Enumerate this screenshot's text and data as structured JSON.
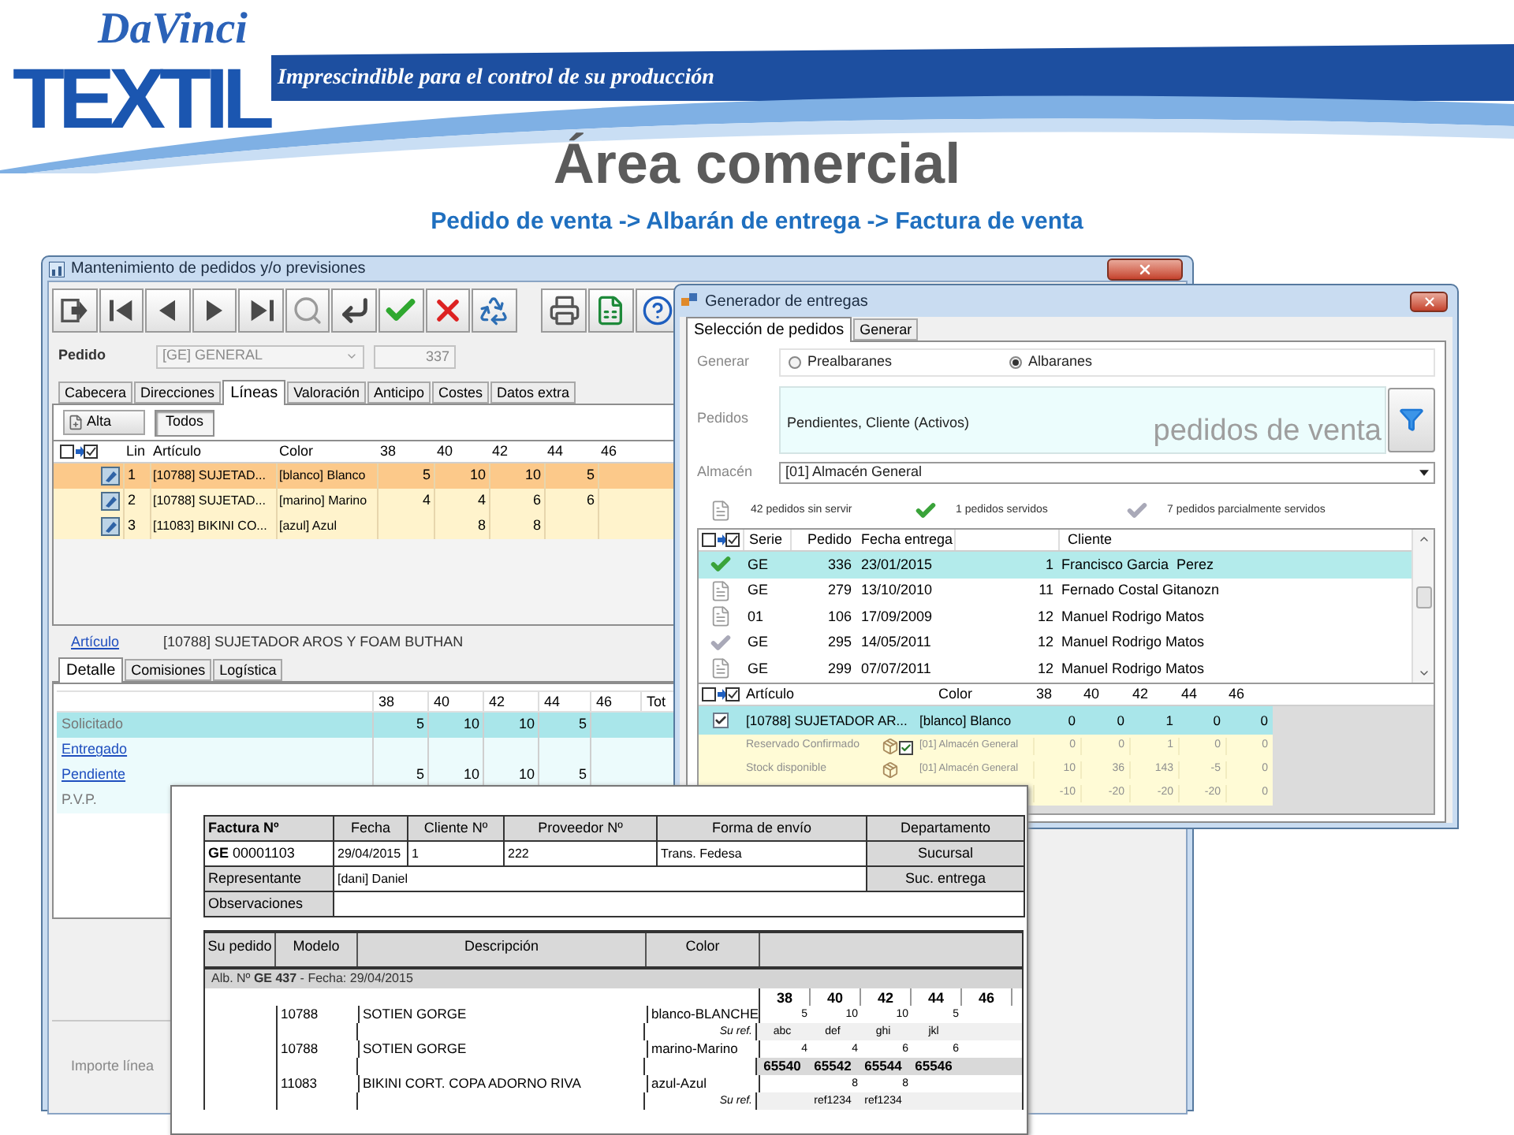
{
  "slide": {
    "logo_top": "DaVinci",
    "logo_main": "TEXTIL",
    "tagline": "Imprescindible para el control de su producción",
    "title": "Área comercial",
    "subtitle": "Pedido de venta -> Albarán de entrega -> Factura de venta"
  },
  "window_pedidos": {
    "title": "Mantenimiento de pedidos y/o previsiones",
    "pedido_label": "Pedido",
    "serie_value": "[GE] GENERAL",
    "numero_value": "337",
    "tabs": [
      {
        "label": "Cabecera",
        "selected": false
      },
      {
        "label": "Direcciones",
        "selected": false
      },
      {
        "label": "Líneas",
        "selected": true
      },
      {
        "label": "Valoración",
        "selected": false
      },
      {
        "label": "Anticipo",
        "selected": false
      },
      {
        "label": "Costes",
        "selected": false
      },
      {
        "label": "Datos extra",
        "selected": false
      }
    ],
    "alta_button": "Alta",
    "todos_toggle": {
      "label": "Todos",
      "pressed": true
    },
    "grid": {
      "columns": [
        "Lin",
        "Artículo",
        "Color",
        "38",
        "40",
        "42",
        "44",
        "46"
      ],
      "rows": [
        {
          "selected": true,
          "lin": "1",
          "articulo": "[10788] SUJETAD...",
          "color_label": "[blanco] Blanco",
          "qty": {
            "s38": "5",
            "s40": "10",
            "s42": "10",
            "s44": "5"
          }
        },
        {
          "selected": false,
          "lin": "2",
          "articulo": "[10788] SUJETAD...",
          "color_label": "[marino] Marino",
          "qty": {
            "s38": "4",
            "s40": "4",
            "s42": "6",
            "s44": "6"
          }
        },
        {
          "selected": false,
          "lin": "3",
          "articulo": "[11083] BIKINI CO...",
          "color_label": "[azul] Azul",
          "qty": {
            "s40": "8",
            "s42": "8"
          }
        }
      ]
    },
    "articulo_link": "Artículo",
    "articulo_value": "[10788] SUJETADOR AROS Y FOAM BUTHAN",
    "detail_tabs": [
      {
        "label": "Detalle",
        "selected": true
      },
      {
        "label": "Comisiones",
        "selected": false
      },
      {
        "label": "Logística",
        "selected": false
      }
    ],
    "detail": {
      "columns": [
        "38",
        "40",
        "42",
        "44",
        "46",
        "Tot"
      ],
      "rows": [
        {
          "label": "Solicitado",
          "kind": "text",
          "selected": true,
          "values": {
            "s38": "5",
            "s40": "10",
            "s42": "10",
            "s44": "5"
          }
        },
        {
          "label": "Entregado",
          "kind": "link",
          "selected": false
        },
        {
          "label": "Pendiente",
          "kind": "link",
          "selected": false,
          "values": {
            "s38": "5",
            "s40": "10",
            "s42": "10",
            "s44": "5"
          }
        },
        {
          "label": "P.V.P.",
          "kind": "text",
          "selected": false
        }
      ]
    },
    "importe_label": "Importe línea"
  },
  "window_entregas": {
    "title": "Generador de entregas",
    "tabs": [
      {
        "label": "Selección de pedidos",
        "selected": true
      },
      {
        "label": "Generar",
        "selected": false
      }
    ],
    "generar_label": "Generar",
    "radios": [
      {
        "label": "Prealbaranes",
        "selected": false
      },
      {
        "label": "Albaranes",
        "selected": true
      }
    ],
    "pedidos_label": "Pedidos",
    "pedidos_value": "Pendientes, Cliente (Activos)",
    "watermark": "pedidos de venta",
    "almacen_label": "Almacén",
    "almacen_value": "[01] Almacén General",
    "legend": [
      {
        "kind": "pending",
        "label": "42 pedidos sin servir"
      },
      {
        "kind": "served",
        "label": "1 pedidos servidos"
      },
      {
        "kind": "partial",
        "label": "7 pedidos parcialmente servidos"
      }
    ],
    "orders": {
      "columns": [
        "Serie",
        "Pedido",
        "Fecha entrega",
        "Cliente"
      ],
      "rows": [
        {
          "kind": "served",
          "selected": true,
          "serie": "GE",
          "pedido": "336",
          "fecha": "23/01/2015",
          "cliente_num": "1",
          "cliente": "Francisco Garcia  Perez"
        },
        {
          "kind": "pending",
          "selected": false,
          "serie": "GE",
          "pedido": "279",
          "fecha": "13/10/2010",
          "cliente_num": "11",
          "cliente": "Fernado Costal Gitanozn"
        },
        {
          "kind": "pending",
          "selected": false,
          "serie": "01",
          "pedido": "106",
          "fecha": "17/09/2009",
          "cliente_num": "12",
          "cliente": "Manuel Rodrigo Matos"
        },
        {
          "kind": "partial",
          "selected": false,
          "serie": "GE",
          "pedido": "295",
          "fecha": "14/05/2011",
          "cliente_num": "12",
          "cliente": "Manuel Rodrigo Matos"
        },
        {
          "kind": "pending",
          "selected": false,
          "serie": "GE",
          "pedido": "299",
          "fecha": "07/07/2011",
          "cliente_num": "12",
          "cliente": "Manuel Rodrigo Matos"
        }
      ]
    },
    "lines": {
      "columns": [
        "Artículo",
        "Color",
        "38",
        "40",
        "42",
        "44",
        "46"
      ],
      "rows": [
        {
          "kind": "line",
          "checked": true,
          "articulo": "[10788] SUJETADOR AR...",
          "color_label": "[blanco] Blanco",
          "values": [
            "0",
            "0",
            "1",
            "0",
            "0"
          ]
        },
        {
          "kind": "stock",
          "confirmed": true,
          "label": "Reservado Confirmado",
          "almacen": "[01] Almacén General",
          "values": [
            "0",
            "0",
            "1",
            "0",
            "0"
          ]
        },
        {
          "kind": "stock",
          "confirmed": false,
          "label": "Stock disponible",
          "almacen": "[01] Almacén General",
          "values": [
            "10",
            "36",
            "143",
            "-5",
            "0"
          ]
        },
        {
          "kind": "stock",
          "values": [
            "-10",
            "-20",
            "-20",
            "-20",
            "0"
          ]
        }
      ]
    }
  },
  "invoice": {
    "header_columns": [
      "Factura Nº",
      "Fecha",
      "Cliente Nº",
      "Proveedor Nº",
      "Forma de envío",
      "Departamento"
    ],
    "factura": "**GE** 00001103",
    "fecha": "29/04/2015",
    "cliente": "1",
    "proveedor": "222",
    "forma_envio": "Trans. Fedesa",
    "sucursal_label": "Sucursal",
    "representante_label": "Representante",
    "representante": "[dani] Daniel",
    "suc_entrega_label": "Suc. entrega",
    "observaciones_label": "Observaciones",
    "line_columns": [
      "Su pedido",
      "Modelo",
      "Descripción",
      "Color"
    ],
    "albaran": "Alb. Nº **GE 437** - Fecha: 29/04/2015",
    "sizes": [
      "38",
      "40",
      "42",
      "44",
      "46"
    ],
    "lines": [
      {
        "modelo": "10788",
        "descripcion": "SOTIEN GORGE",
        "color_label": "blanco-BLANCHE",
        "qty": {
          "s38": "5",
          "s40": "10",
          "s42": "10",
          "s44": "5"
        },
        "sub": {
          "kind": "refs",
          "label": "Su ref.",
          "values": {
            "s38": "abc",
            "s40": "def",
            "s42": "ghi",
            "s44": "jkl"
          }
        }
      },
      {
        "modelo": "10788",
        "descripcion": "SOTIEN GORGE",
        "color_label": "marino-Marino",
        "qty": {
          "s38": "4",
          "s40": "4",
          "s42": "6",
          "s44": "6"
        },
        "sub": {
          "kind": "codes",
          "values": {
            "s38": "65540",
            "s40": "65542",
            "s42": "65544",
            "s44": "65546"
          }
        }
      },
      {
        "modelo": "11083",
        "descripcion": "BIKINI CORT. COPA ADORNO RIVA",
        "color_label": "azul-Azul",
        "qty": {
          "s40": "8",
          "s42": "8"
        },
        "sub": {
          "kind": "refs",
          "label": "Su ref.",
          "values": {
            "s40": "ref1234",
            "s42": "ref1234"
          }
        }
      }
    ]
  }
}
